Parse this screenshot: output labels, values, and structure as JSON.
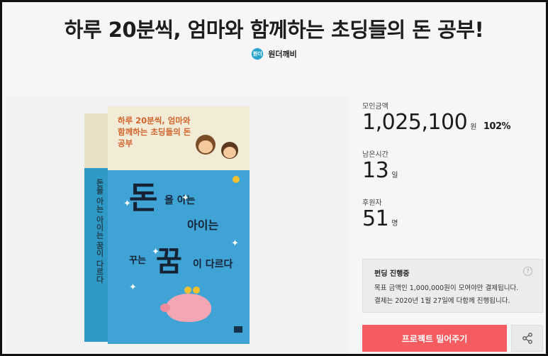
{
  "header": {
    "title": "하루 20분씩, 엄마와 함께하는 초딩들의 돈 공부!",
    "creator": {
      "avatar_text": "원더",
      "name": "원더깨비"
    }
  },
  "book": {
    "subtitle": "하루 20분씩, 엄마와 함께하는 초딩들의 돈 공부",
    "spine_text": "돈을 아는 아이는 꿈이 다르다",
    "headline": {
      "big1": "돈",
      "small1": "을 아는",
      "small2": "아이는",
      "small3": "꾸는",
      "big2": "꿈",
      "small4": "이 다르다"
    }
  },
  "stats": {
    "raised_label": "모인금액",
    "raised_value": "1,025,100",
    "raised_unit": "원",
    "raised_percent": "102%",
    "time_label": "남은시간",
    "time_value": "13",
    "time_unit": "일",
    "backers_label": "후원자",
    "backers_value": "51",
    "backers_unit": "명"
  },
  "notice": {
    "title": "펀딩 진행중",
    "line1": "목표 금액인 1,000,000원이 모여야만 결제됩니다.",
    "line2": "결제는 2020년 1월 27일에 다함께 진행됩니다.",
    "help_icon": "?"
  },
  "actions": {
    "cta_label": "프로젝트 밀어주기",
    "share_icon": "share-icon"
  },
  "colors": {
    "cta": "#f45c5f",
    "cover_blue": "#3fa3d5"
  }
}
